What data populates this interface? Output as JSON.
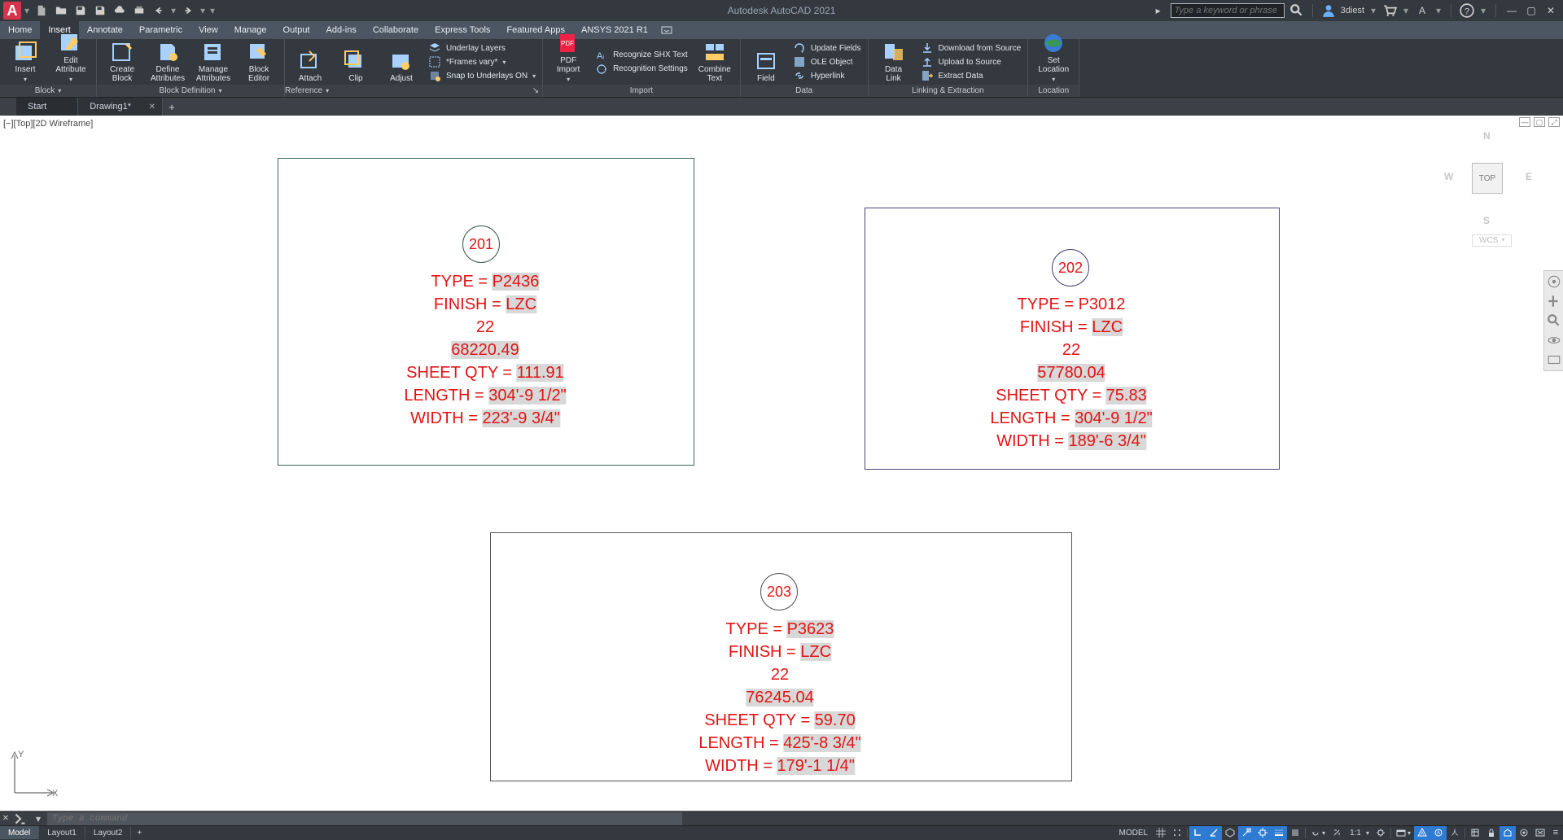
{
  "title": "Autodesk AutoCAD 2021",
  "search_placeholder": "Type a keyword or phrase",
  "user": "3diest",
  "menutabs": [
    "Home",
    "Insert",
    "Annotate",
    "Parametric",
    "View",
    "Manage",
    "Output",
    "Add-ins",
    "Collaborate",
    "Express Tools",
    "Featured Apps",
    "ANSYS 2021 R1"
  ],
  "menutab_active": 1,
  "ribbon": {
    "block": {
      "label": "Block",
      "insert": "Insert",
      "editattr": "Edit\nAttribute"
    },
    "blockdef": {
      "label": "Block Definition",
      "create": "Create\nBlock",
      "define": "Define\nAttributes",
      "manage": "Manage\nAttributes",
      "editor": "Block\nEditor"
    },
    "reference": {
      "label": "Reference",
      "attach": "Attach",
      "clip": "Clip",
      "adjust": "Adjust",
      "underlay": "Underlay Layers",
      "frames": "*Frames vary*",
      "snap": "Snap to Underlays ON"
    },
    "import": {
      "label": "Import",
      "pdf": "PDF\nImport",
      "shx": "Recognize SHX Text",
      "recog": "Recognition Settings",
      "combine": "Combine\nText"
    },
    "data": {
      "label": "Data",
      "field": "Field",
      "update": "Update Fields",
      "ole": "OLE Object",
      "hyperlink": "Hyperlink",
      "datalink": "Data\nLink"
    },
    "linking": {
      "label": "Linking & Extraction",
      "download": "Download from Source",
      "upload": "Upload to Source",
      "extract": "Extract Data"
    },
    "location": {
      "label": "Location",
      "set": "Set\nLocation"
    }
  },
  "filetabs": [
    {
      "label": "Start",
      "close": false
    },
    {
      "label": "Drawing1*",
      "close": true
    }
  ],
  "vpstate": "[−][Top][2D Wireframe]",
  "viewcube": {
    "n": "N",
    "s": "S",
    "e": "E",
    "w": "W",
    "top": "TOP",
    "wcs": "WCS"
  },
  "blocks": {
    "b1": {
      "tag": "201",
      "type_l": "TYPE = ",
      "type_v": "P2436",
      "fin_l": "FINISH = ",
      "fin_v": "LZC",
      "v22": "22",
      "num": "68220.49",
      "sq_l": "SHEET QTY = ",
      "sq_v": "111.91",
      "len_l": "LENGTH = ",
      "len_v": "304'-9 1/2\"",
      "wid_l": "WIDTH = ",
      "wid_v": "223'-9 3/4\""
    },
    "b2": {
      "tag": "202",
      "type_l": "TYPE = ",
      "type_v": "P3012",
      "fin_l": "FINISH = ",
      "fin_v": "LZC",
      "v22": "22",
      "num": "57780.04",
      "sq_l": "SHEET QTY = ",
      "sq_v": "75.83",
      "len_l": "LENGTH = ",
      "len_v": "304'-9 1/2\"",
      "wid_l": "WIDTH = ",
      "wid_v": "189'-6 3/4\""
    },
    "b3": {
      "tag": "203",
      "type_l": "TYPE = ",
      "type_v": "P3623",
      "fin_l": "FINISH = ",
      "fin_v": "LZC",
      "v22": "22",
      "num": "76245.04",
      "sq_l": "SHEET QTY = ",
      "sq_v": "59.70",
      "len_l": "LENGTH = ",
      "len_v": "425'-8 3/4\"",
      "wid_l": "WIDTH = ",
      "wid_v": "179'-1 1/4\""
    }
  },
  "cmd_placeholder": "Type a command",
  "layouttabs": [
    "Model",
    "Layout1",
    "Layout2"
  ],
  "layouttab_active": 0,
  "status": {
    "model": "MODEL",
    "scale": "1:1"
  },
  "ucs": {
    "y": "Y",
    "x": "X"
  }
}
